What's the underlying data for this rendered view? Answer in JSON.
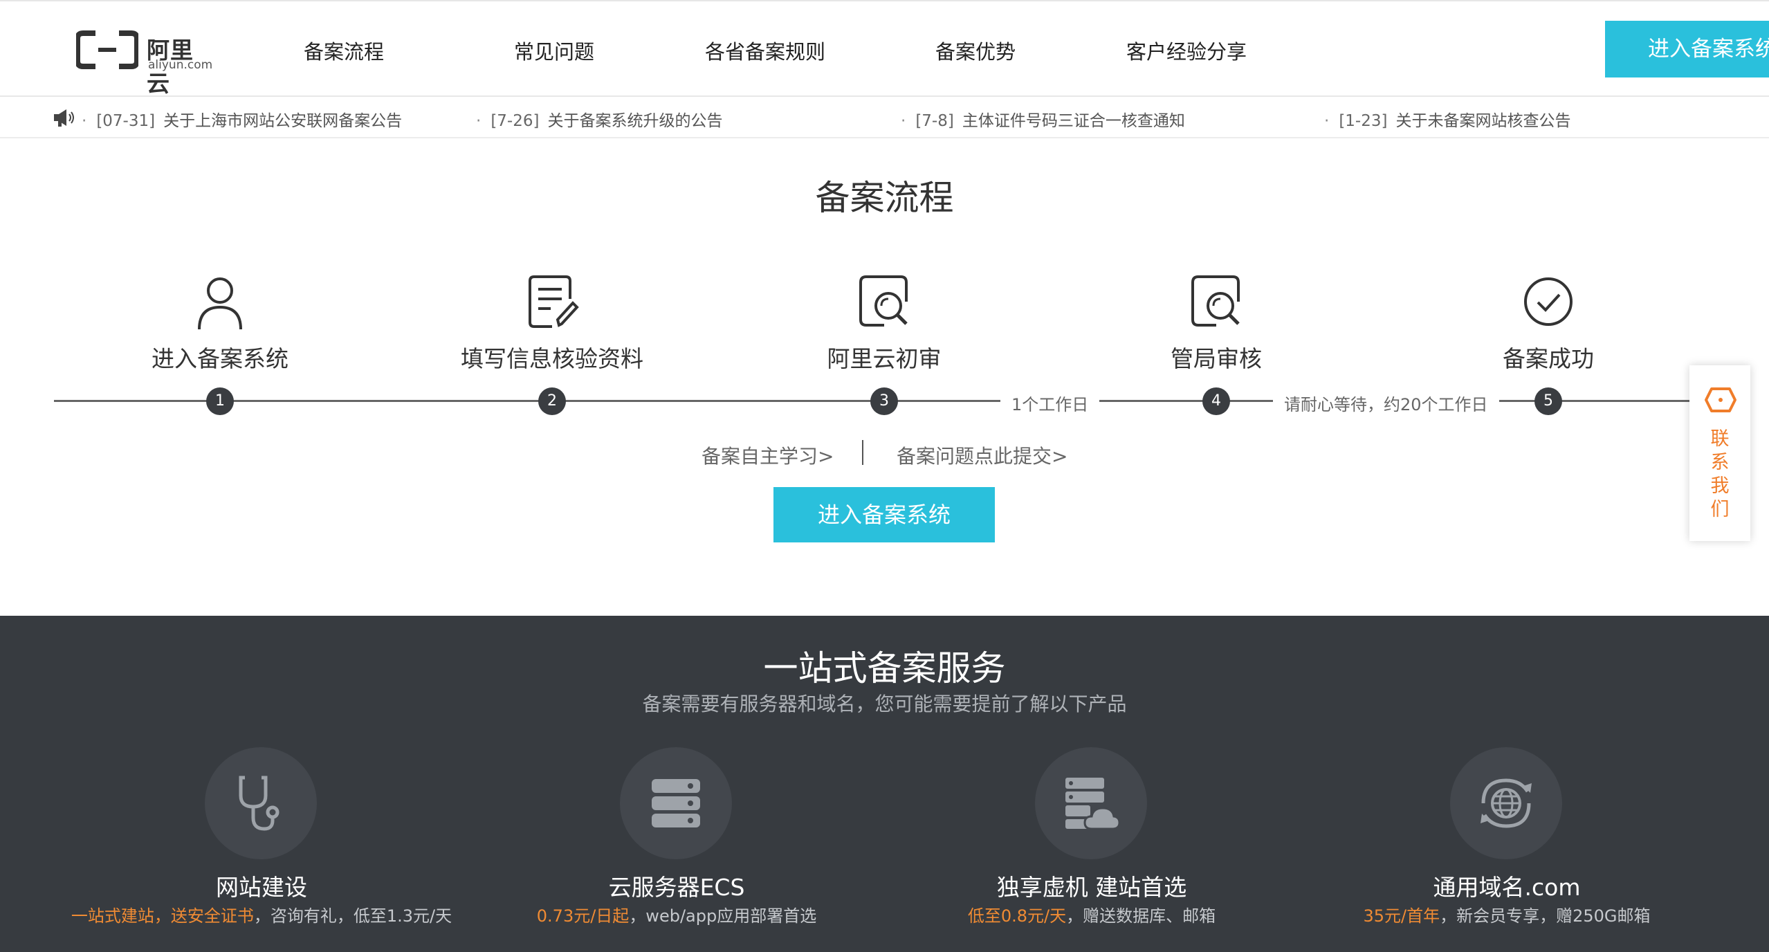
{
  "logo": {
    "name_cn": "阿里云",
    "name_en": "aliyun.com"
  },
  "nav": {
    "items": [
      "备案流程",
      "常见问题",
      "各省备案规则",
      "备案优势",
      "客户经验分享"
    ],
    "cta_label": "进入备案系统"
  },
  "notices": [
    {
      "date": "[07-31]",
      "text": "关于上海市网站公安联网备案公告"
    },
    {
      "date": "[7-26]",
      "text": "关于备案系统升级的公告"
    },
    {
      "date": "[7-8]",
      "text": "主体证件号码三证合一核查通知"
    },
    {
      "date": "[1-23]",
      "text": "关于未备案网站核查公告"
    }
  ],
  "process": {
    "title": "备案流程",
    "steps": [
      {
        "number": "1",
        "label": "进入备案系统",
        "icon": "user-icon"
      },
      {
        "number": "2",
        "label": "填写信息核验资料",
        "icon": "edit-form-icon"
      },
      {
        "number": "3",
        "label": "阿里云初审",
        "icon": "search-review-icon"
      },
      {
        "number": "4",
        "label": "管局审核",
        "icon": "search-review-icon"
      },
      {
        "number": "5",
        "label": "备案成功",
        "icon": "check-circle-icon"
      }
    ],
    "durations": [
      "1个工作日",
      "请耐心等待，约20个工作日"
    ],
    "study_link": "备案自主学习>",
    "submit_link": "备案问题点此提交>",
    "cta_label": "进入备案系统"
  },
  "contact": {
    "chars": [
      "联",
      "系",
      "我",
      "们"
    ]
  },
  "services": {
    "title": "一站式备案服务",
    "subtitle": "备案需要有服务器和域名，您可能需要提前了解以下产品",
    "items": [
      {
        "name": "网站建设",
        "highlight": "一站式建站，送安全证书",
        "desc": "，咨询有礼，低至1.3元/天",
        "icon": "stethoscope-icon"
      },
      {
        "name": "云服务器ECS",
        "highlight": "0.73元/日起",
        "desc": "，web/app应用部署首选",
        "icon": "server-stack-icon"
      },
      {
        "name": "独享虚机 建站首选",
        "highlight": "低至0.8元/天",
        "desc": "，赠送数据库、邮箱",
        "icon": "cloud-server-icon"
      },
      {
        "name": "通用域名.com",
        "highlight": "35元/首年",
        "desc": "，新会员专享，赠250G邮箱",
        "icon": "globe-refresh-icon"
      }
    ]
  },
  "colors": {
    "accent": "#2ac0dc",
    "dark_bg": "#373b40",
    "highlight": "#f08b33",
    "contact": "#f07d2a"
  }
}
